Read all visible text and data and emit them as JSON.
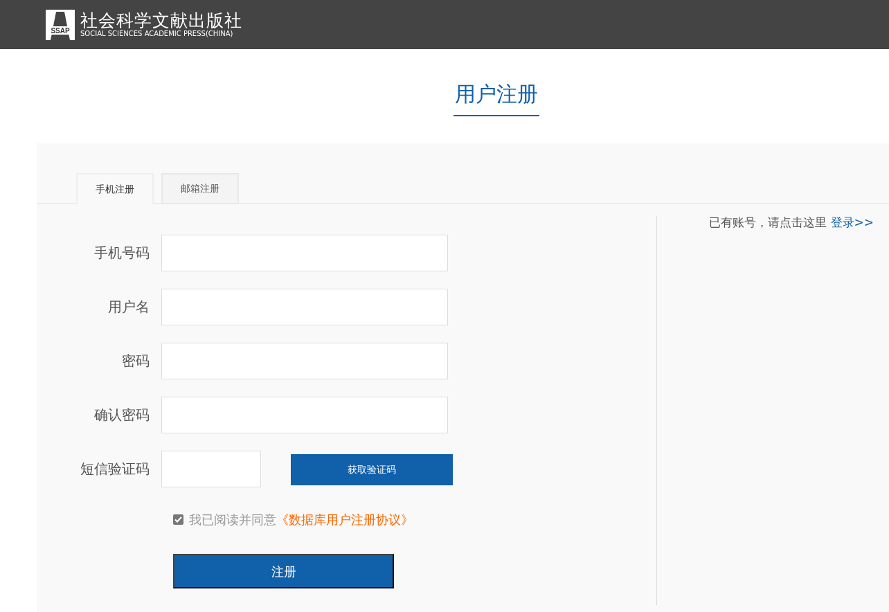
{
  "header": {
    "logo_mark": "SSAP",
    "name": "社会科学文献出版社",
    "name_en": "SOCIAL SCIENCES ACADEMIC PRESS(CHINA)"
  },
  "title": "用户注册",
  "tabs": [
    {
      "label": "手机注册",
      "selected": true
    },
    {
      "label": "邮箱注册",
      "selected": false
    }
  ],
  "fields": [
    {
      "label": "手机号码",
      "kind": "text"
    },
    {
      "label": "用户名",
      "kind": "text"
    },
    {
      "label": "密码",
      "kind": "password"
    },
    {
      "label": "确认密码",
      "kind": "password"
    },
    {
      "label": "短信验证码",
      "kind": "sms",
      "button": "获取验证码"
    }
  ],
  "agreement": {
    "checked": true,
    "text": "我已阅读并同意",
    "link": "《数据库用户注册协议》"
  },
  "submit": "注册",
  "login_prompt": {
    "text": "已有账号，请点击这里",
    "link": "登录>>"
  }
}
